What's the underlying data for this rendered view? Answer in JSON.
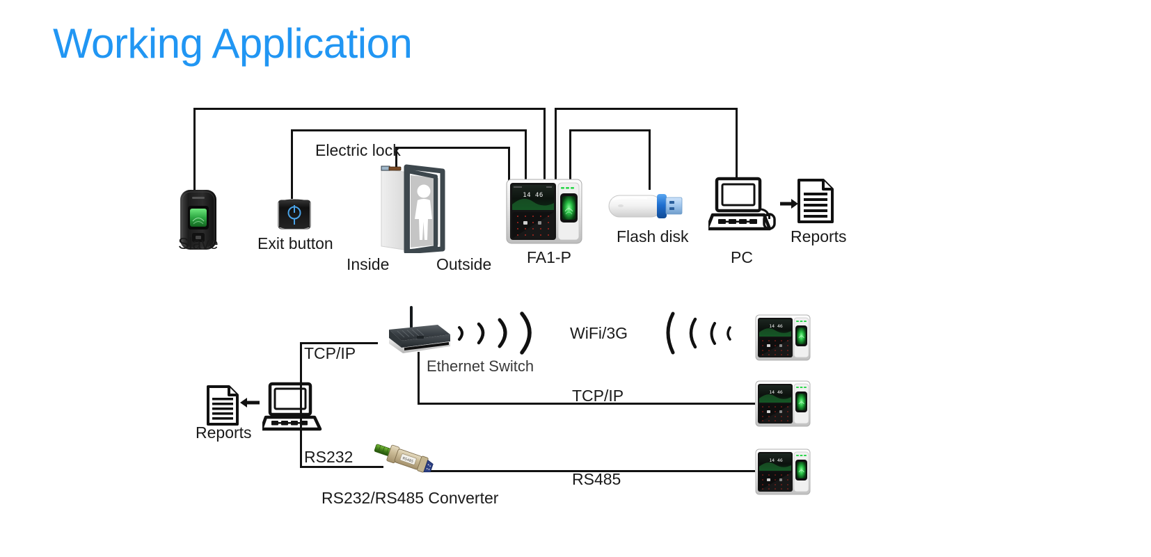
{
  "title": "Working Application",
  "theme": {
    "title_color": "#2196f3",
    "line_color": "#111111",
    "background": "#ffffff",
    "device_green": "#2fbf4a",
    "usb_blue": "#1f6fd0",
    "door_frame": "#3d474d"
  },
  "top_row": {
    "slave_label": "Slave",
    "exit_button_label": "Exit button",
    "electric_lock_label": "Electric lock",
    "inside_label": "Inside",
    "outside_label": "Outside",
    "fa1p_label": "FA1-P",
    "flash_disk_label": "Flash disk",
    "pc_label": "PC",
    "reports_label": "Reports",
    "device_time": "14 46"
  },
  "bottom_row": {
    "reports_label": "Reports",
    "tcpip_label_left": "TCP/IP",
    "ethernet_switch_label": "Ethernet Switch",
    "wifi_label": "WiFi/3G",
    "tcpip_label_mid": "TCP/IP",
    "rs232_label": "RS232",
    "converter_label": "RS232/RS485 Converter",
    "rs485_label": "RS485",
    "device_time": "14 46"
  },
  "terminals": [
    {
      "name": "terminal-wifi",
      "time": "14 46"
    },
    {
      "name": "terminal-tcpip",
      "time": "14 46"
    },
    {
      "name": "terminal-rs485",
      "time": "14 46"
    }
  ]
}
